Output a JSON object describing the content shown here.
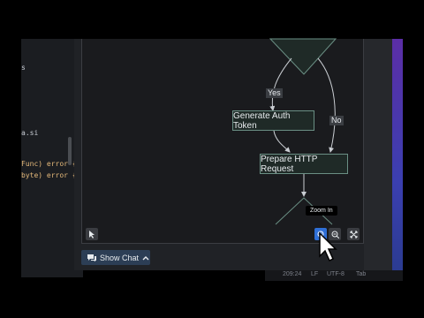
{
  "editor": {
    "code_lines": [
      {
        "text": "s"
      },
      {
        "text": "a.si"
      },
      {
        "text": "Func) error {"
      },
      {
        "text": "byte) error {"
      }
    ]
  },
  "flowchart": {
    "nodes": {
      "generate": "Generate Auth Token",
      "prepare": "Prepare HTTP Request"
    },
    "edge_labels": {
      "yes": "Yes",
      "no": "No"
    }
  },
  "toolbar": {
    "tooltip": "Zoom In",
    "tools": [
      "select-tool",
      "zoom-in",
      "zoom-out",
      "fit-view"
    ]
  },
  "chat": {
    "show_chat_label": "Show Chat"
  },
  "status_bar": {
    "position": "209:24",
    "eol": "LF",
    "encoding": "UTF-8",
    "indent": "Tab"
  },
  "colors": {
    "node_border": "#6a8f84",
    "accent_blue": "#2f6fd6",
    "purple": "#5b2ea6"
  }
}
